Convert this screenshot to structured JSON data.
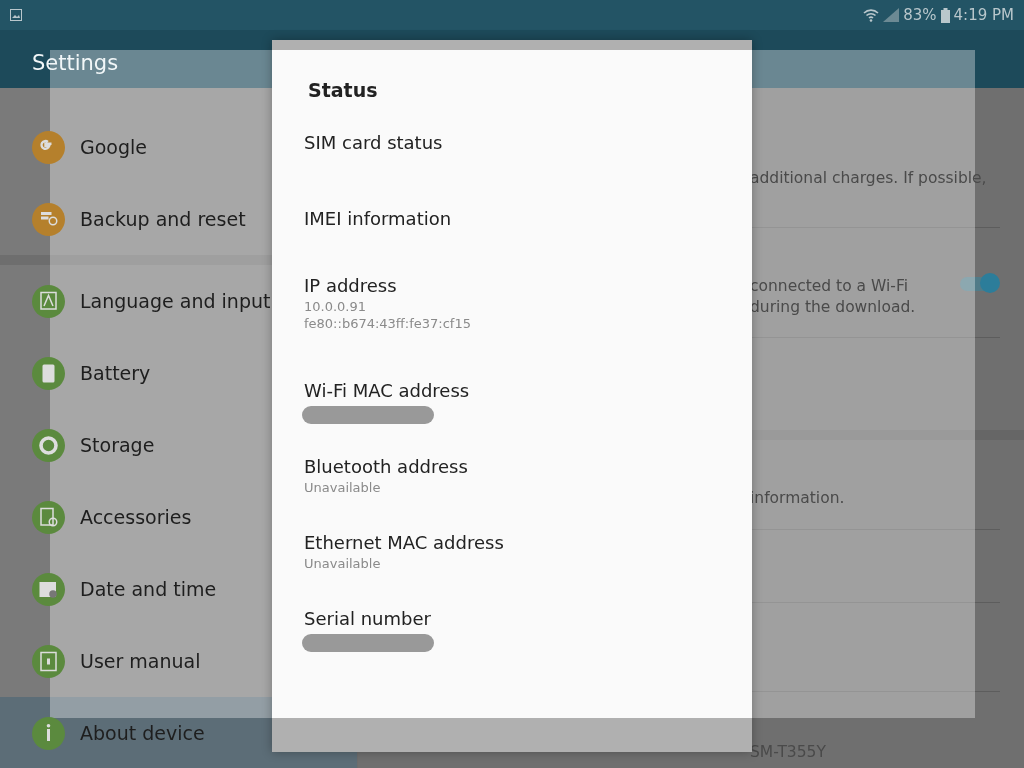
{
  "status_bar": {
    "battery": "83%",
    "time": "4:19 PM"
  },
  "header": {
    "title": "Settings"
  },
  "sidebar": {
    "groups": [
      {
        "items": [
          {
            "label": "Google",
            "color": "#b5802c",
            "selected": false
          },
          {
            "label": "Backup and reset",
            "color": "#b5802c",
            "selected": false
          }
        ]
      },
      {
        "items": [
          {
            "label": "Language and input",
            "color": "#5b8a3e",
            "selected": false
          },
          {
            "label": "Battery",
            "color": "#5b8a3e",
            "selected": false
          },
          {
            "label": "Storage",
            "color": "#5b8a3e",
            "selected": false
          },
          {
            "label": "Accessories",
            "color": "#5b8a3e",
            "selected": false
          },
          {
            "label": "Date and time",
            "color": "#5b8a3e",
            "selected": false
          },
          {
            "label": "User manual",
            "color": "#5b8a3e",
            "selected": false
          },
          {
            "label": "About device",
            "color": "#5b8a3e",
            "selected": true
          }
        ]
      }
    ]
  },
  "detail": {
    "sections": [
      {
        "rows": [
          {
            "kind": "text",
            "lines": [
              "additional charges. If possible,"
            ]
          },
          {
            "kind": "text",
            "lines": [
              "connected to a Wi-Fi",
              "during the download."
            ],
            "toggle": {
              "on": true
            }
          },
          {
            "kind": "blank"
          }
        ]
      },
      {
        "rows": [
          {
            "kind": "text",
            "lines": [
              "information."
            ]
          },
          {
            "kind": "blank"
          },
          {
            "kind": "blank"
          },
          {
            "kind": "text",
            "lines": [
              "SM-T355Y"
            ]
          }
        ]
      }
    ]
  },
  "dialog": {
    "title": "Status",
    "items": [
      {
        "title": "SIM card status"
      },
      {
        "title": "IMEI information"
      },
      {
        "title": "IP address",
        "summary": [
          "10.0.0.91",
          "fe80::b674:43ff:fe37:cf15"
        ]
      },
      {
        "title": "Wi-Fi MAC address",
        "redacted": true
      },
      {
        "title": "Bluetooth address",
        "summary": [
          "Unavailable"
        ]
      },
      {
        "title": "Ethernet MAC address",
        "summary": [
          "Unavailable"
        ]
      },
      {
        "title": "Serial number",
        "redacted": true
      }
    ]
  }
}
